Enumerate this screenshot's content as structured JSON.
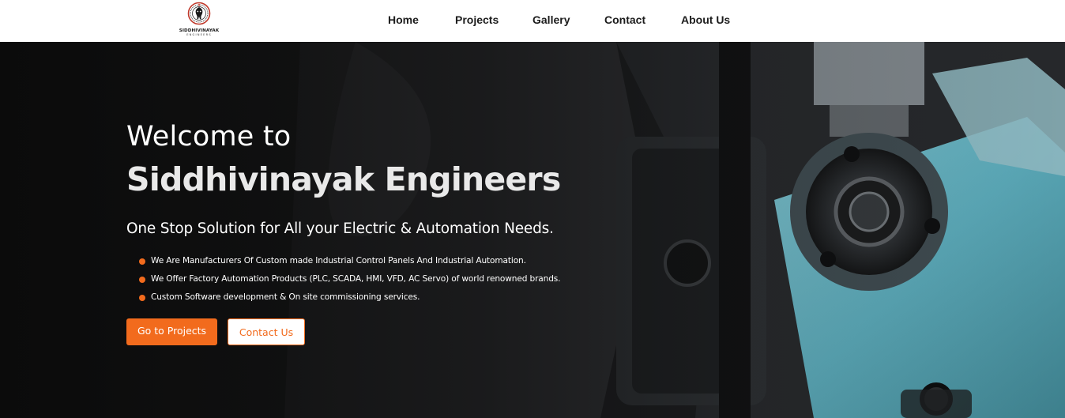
{
  "brand": {
    "name": "SIDDHIVINAYAK",
    "sub": "ENGINEERS",
    "logo_icon": "ganesha-emblem-icon"
  },
  "nav": {
    "items": [
      {
        "label": "Home"
      },
      {
        "label": "Projects"
      },
      {
        "label": "Gallery"
      },
      {
        "label": "Contact"
      },
      {
        "label": "About Us"
      }
    ]
  },
  "hero": {
    "welcome": "Welcome to",
    "company": "Siddhivinayak Engineers",
    "tagline": "One Stop Solution for All your Electric & Automation Needs.",
    "features": [
      "We Are Manufacturers Of Custom made Industrial Control Panels And Industrial Automation.",
      "We Offer Factory Automation Products (PLC, SCADA, HMI, VFD, AC Servo) of world renowned brands.",
      "Custom Software development & On site commissioning services."
    ],
    "primary_button": "Go to Projects",
    "secondary_button": "Contact Us",
    "background_image": "industrial-machine-photo"
  },
  "colors": {
    "accent": "#f26b1d",
    "nav_bg": "#ffffff",
    "nav_text": "#1c1c1c",
    "hero_text": "#ffffff",
    "machine_blue": "#5aa7b6"
  }
}
